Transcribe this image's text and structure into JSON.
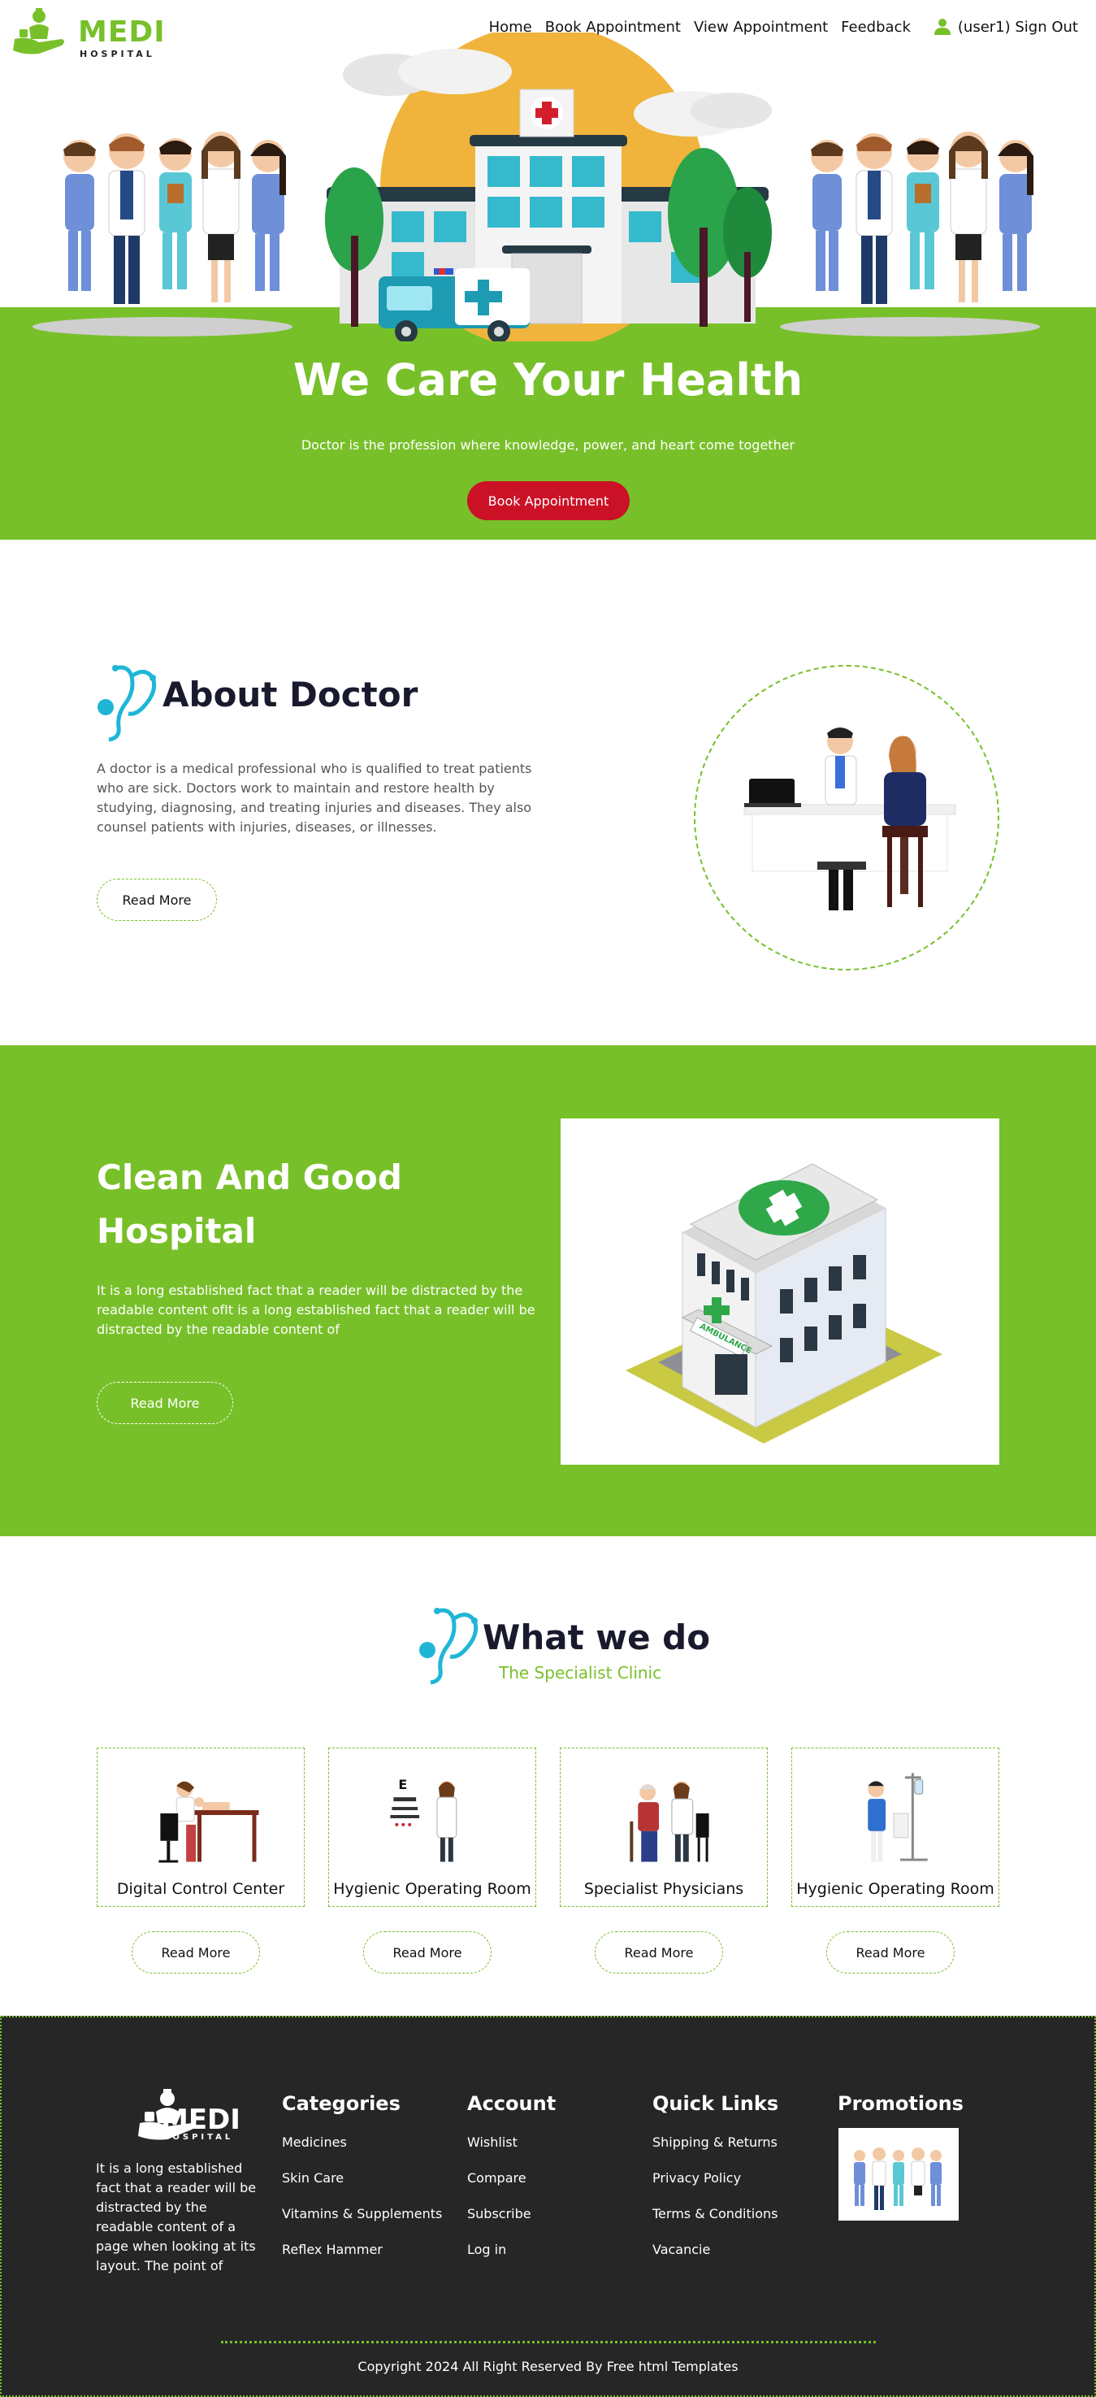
{
  "header": {
    "logo": {
      "word": "MEDI",
      "sub": "HOSPITAL"
    },
    "nav": [
      "Home",
      "Book Appointment",
      "View Appointment",
      "Feedback"
    ],
    "user_label": "(user1) Sign Out"
  },
  "hero": {
    "title": "We Care Your Health",
    "subtitle": "Doctor is the profession where knowledge, power, and heart come together",
    "button": "Book Appointment"
  },
  "about": {
    "title": "About Doctor",
    "text": "A doctor is a medical professional who is qualified to treat patients who are sick. Doctors work to maintain and restore health by studying, diagnosing, and treating injuries and diseases. They also counsel patients with injuries, diseases, or illnesses.",
    "button": "Read More"
  },
  "hospital": {
    "title": "Clean And Good Hospital",
    "text": "It is a long established fact that a reader will be distracted by the readable content ofIt is a long established fact that a reader will be distracted by the readable content of",
    "button": "Read More",
    "ambulance_sign": "AMBULANCE"
  },
  "what_we_do": {
    "title": "What we do",
    "subtitle": "The Specialist Clinic",
    "cards": [
      {
        "label": "Digital Control Center",
        "button": "Read More"
      },
      {
        "label": "Hygienic Operating Room",
        "button": "Read More"
      },
      {
        "label": "Specialist Physicians",
        "button": "Read More"
      },
      {
        "label": "Hygienic Operating Room",
        "button": "Read More"
      }
    ]
  },
  "footer": {
    "logo": {
      "word": "MEDI",
      "sub": "HOSPITAL"
    },
    "about": "It is a long established fact that a reader will be distracted by the readable content of a page when looking at its layout. The point of",
    "columns": [
      {
        "title": "Categories",
        "links": [
          "Medicines",
          "Skin Care",
          "Vitamins & Supplements",
          "Reflex Hammer"
        ]
      },
      {
        "title": "Account",
        "links": [
          "Wishlist",
          "Compare",
          "Subscribe",
          "Log in"
        ]
      },
      {
        "title": "Quick Links",
        "links": [
          "Shipping & Returns",
          "Privacy Policy",
          "Terms & Conditions",
          "Vacancie"
        ]
      }
    ],
    "promotions_title": "Promotions",
    "copyright": "Copyright 2024 All Right Reserved By Free html Templates"
  },
  "colors": {
    "brand_green": "#78c02a",
    "accent_red": "#cb1126",
    "footer_bg": "#262626",
    "icon_cyan": "#1fb6d6"
  }
}
